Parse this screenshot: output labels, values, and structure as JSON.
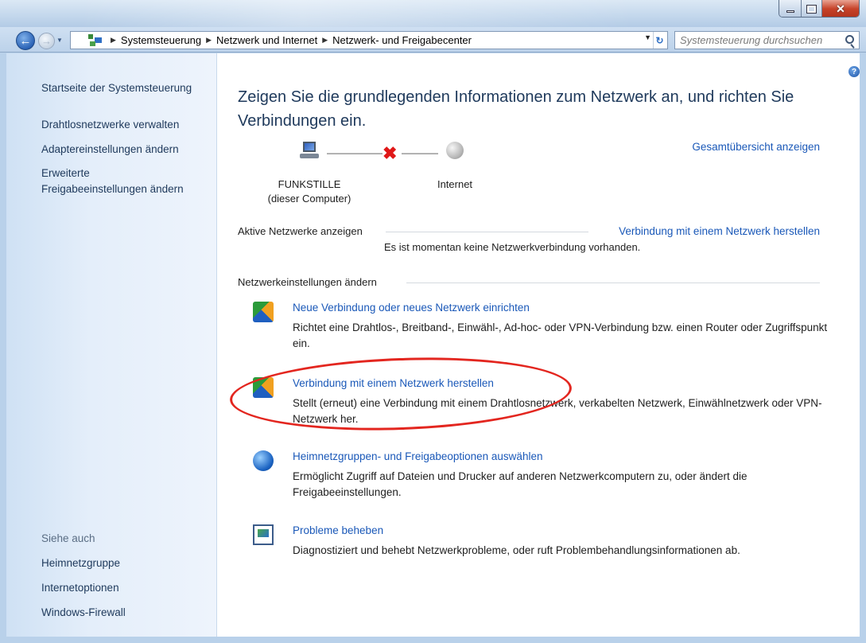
{
  "address": {
    "crumbs": [
      "Systemsteuerung",
      "Netzwerk und Internet",
      "Netzwerk- und Freigabecenter"
    ]
  },
  "search": {
    "placeholder": "Systemsteuerung durchsuchen"
  },
  "sidebar": {
    "home": "Startseite der Systemsteuerung",
    "items": [
      "Drahtlosnetzwerke verwalten",
      "Adaptereinstellungen ändern",
      "Erweiterte",
      "Freigabeeinstellungen ändern"
    ],
    "see_also_heading": "Siehe auch",
    "see_also": [
      "Heimnetzgruppe",
      "Internetoptionen",
      "Windows-Firewall"
    ]
  },
  "main": {
    "title": "Zeigen Sie die grundlegenden Informationen zum Netzwerk an, und richten Sie Verbindungen ein.",
    "overview_link": "Gesamtübersicht anzeigen",
    "map": {
      "computer_name": "FUNKSTILLE",
      "computer_sub": "(dieser Computer)",
      "internet_label": "Internet"
    },
    "active_networks": {
      "heading": "Aktive Netzwerke anzeigen",
      "link": "Verbindung mit einem Netzwerk herstellen",
      "status": "Es ist momentan keine Netzwerkverbindung vorhanden."
    },
    "settings_heading": "Netzwerkeinstellungen ändern",
    "tasks": [
      {
        "link": "Neue Verbindung oder neues Netzwerk einrichten",
        "desc": "Richtet eine Drahtlos-, Breitband-, Einwähl-, Ad-hoc- oder VPN-Verbindung bzw. einen Router oder Zugriffspunkt ein."
      },
      {
        "link": "Verbindung mit einem Netzwerk herstellen",
        "desc": "Stellt (erneut) eine Verbindung mit einem Drahtlosnetzwerk, verkabelten Netzwerk, Einwählnetzwerk oder VPN-Netzwerk her."
      },
      {
        "link": "Heimnetzgruppen- und Freigabeoptionen auswählen",
        "desc": "Ermöglicht Zugriff auf Dateien und Drucker auf anderen Netzwerkcomputern zu, oder ändert die Freigabeeinstellungen."
      },
      {
        "link": "Probleme beheben",
        "desc": "Diagnostiziert und behebt Netzwerkprobleme, oder ruft Problembehandlungsinformationen ab."
      }
    ]
  },
  "colors": {
    "link": "#1a58b8",
    "title": "#1e395b",
    "annotation": "#e3261f",
    "close_button": "#c7432a"
  }
}
